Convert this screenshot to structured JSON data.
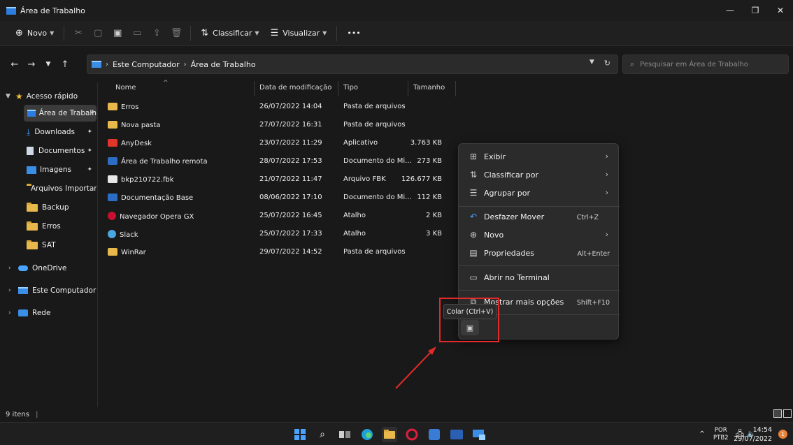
{
  "window": {
    "title": "Área de Trabalho",
    "controls": {
      "minimize": "—",
      "maximize": "❐",
      "close": "✕"
    }
  },
  "commandbar": {
    "new_label": "Novo",
    "sort_label": "Classificar",
    "view_label": "Visualizar",
    "more_label": "•••"
  },
  "address": {
    "crumbs": [
      "Este Computador",
      "Área de Trabalho"
    ],
    "search_placeholder": "Pesquisar em Área de Trabalho"
  },
  "sidebar": {
    "quick_access": "Acesso rápido",
    "items": [
      {
        "label": "Área de Trabalh"
      },
      {
        "label": "Downloads"
      },
      {
        "label": "Documentos"
      },
      {
        "label": "Imagens"
      },
      {
        "label": "Arquivos Importar"
      },
      {
        "label": "Backup"
      },
      {
        "label": "Erros"
      },
      {
        "label": "SAT"
      }
    ],
    "onedrive": "OneDrive",
    "computer": "Este Computador",
    "network": "Rede"
  },
  "columns": {
    "name": "Nome",
    "modified": "Data de modificação",
    "type": "Tipo",
    "size": "Tamanho"
  },
  "files": [
    {
      "name": "Erros",
      "modified": "26/07/2022 14:04",
      "type": "Pasta de arquivos",
      "size": "",
      "icon": "folder"
    },
    {
      "name": "Nova pasta",
      "modified": "27/07/2022 16:31",
      "type": "Pasta de arquivos",
      "size": "",
      "icon": "folder"
    },
    {
      "name": "AnyDesk",
      "modified": "23/07/2022 11:29",
      "type": "Aplicativo",
      "size": "3.763 KB",
      "icon": "anydesk"
    },
    {
      "name": "Área de Trabalho remota",
      "modified": "28/07/2022 17:53",
      "type": "Documento do Mi...",
      "size": "273 KB",
      "icon": "word"
    },
    {
      "name": "bkp210722.fbk",
      "modified": "21/07/2022 11:47",
      "type": "Arquivo FBK",
      "size": "126.677 KB",
      "icon": "file"
    },
    {
      "name": "Documentação Base",
      "modified": "08/06/2022 17:10",
      "type": "Documento do Mi...",
      "size": "112 KB",
      "icon": "word"
    },
    {
      "name": "Navegador Opera GX",
      "modified": "25/07/2022 16:45",
      "type": "Atalho",
      "size": "2 KB",
      "icon": "opera"
    },
    {
      "name": "Slack",
      "modified": "25/07/2022 17:33",
      "type": "Atalho",
      "size": "3 KB",
      "icon": "slack"
    },
    {
      "name": "WinRar",
      "modified": "29/07/2022 14:52",
      "type": "Pasta de arquivos",
      "size": "",
      "icon": "folder"
    }
  ],
  "status": {
    "item_count": "9 itens"
  },
  "context_menu": {
    "items": [
      {
        "label": "Exibir",
        "shortcut": "",
        "submenu": true,
        "glyph": "⊞"
      },
      {
        "label": "Classificar por",
        "shortcut": "",
        "submenu": true,
        "glyph": "⇅"
      },
      {
        "label": "Agrupar por",
        "shortcut": "",
        "submenu": true,
        "glyph": "☰"
      },
      {
        "label": "Desfazer Mover",
        "shortcut": "Ctrl+Z",
        "submenu": false,
        "glyph": "↶"
      },
      {
        "label": "Novo",
        "shortcut": "",
        "submenu": true,
        "glyph": "⊕"
      },
      {
        "label": "Propriedades",
        "shortcut": "Alt+Enter",
        "submenu": false,
        "glyph": "▤"
      },
      {
        "label": "Abrir no Terminal",
        "shortcut": "",
        "submenu": false,
        "glyph": "▭"
      },
      {
        "label": "Mostrar mais opções",
        "shortcut": "Shift+F10",
        "submenu": false,
        "glyph": "⧉"
      }
    ],
    "paste_tooltip": "Colar (Ctrl+V)"
  },
  "taskbar": {
    "language": "POR",
    "layout": "PTB2",
    "time": "14:54",
    "date": "29/07/2022",
    "notification_count": "1"
  },
  "colors": {
    "background": "#191919",
    "menu": "#2b2b2b",
    "highlight": "#e12a2a",
    "folder": "#e8b84a"
  }
}
